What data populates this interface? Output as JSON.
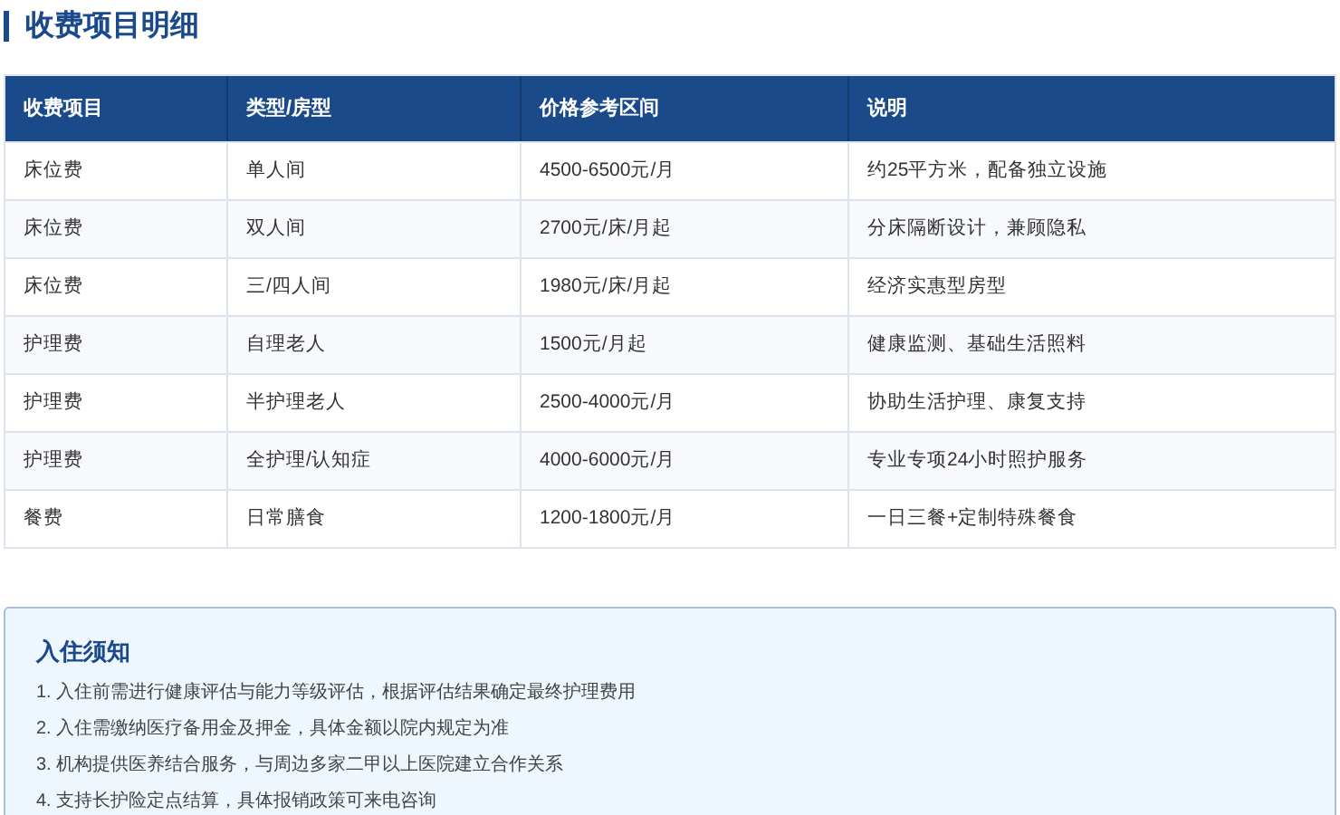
{
  "section_title": "收费项目明细",
  "table": {
    "columns": [
      "收费项目",
      "类型/房型",
      "价格参考区间",
      "说明"
    ],
    "rows": [
      [
        "床位费",
        "单人间",
        "4500-6500元/月",
        "约25平方米，配备独立设施"
      ],
      [
        "床位费",
        "双人间",
        "2700元/床/月起",
        "分床隔断设计，兼顾隐私"
      ],
      [
        "床位费",
        "三/四人间",
        "1980元/床/月起",
        "经济实惠型房型"
      ],
      [
        "护理费",
        "自理老人",
        "1500元/月起",
        "健康监测、基础生活照料"
      ],
      [
        "护理费",
        "半护理老人",
        "2500-4000元/月",
        "协助生活护理、康复支持"
      ],
      [
        "护理费",
        "全护理/认知症",
        "4000-6000元/月",
        "专业专项24小时照护服务"
      ],
      [
        "餐费",
        "日常膳食",
        "1200-1800元/月",
        "一日三餐+定制特殊餐食"
      ]
    ]
  },
  "notice": {
    "title": "入住须知",
    "items": [
      "1. 入住前需进行健康评估与能力等级评估，根据评估结果确定最终护理费用",
      "2. 入住需缴纳医疗备用金及押金，具体金额以院内规定为准",
      "3. 机构提供医养结合服务，与周边多家二甲以上医院建立合作关系",
      "4. 支持长护险定点结算，具体报销政策可来电咨询"
    ]
  }
}
